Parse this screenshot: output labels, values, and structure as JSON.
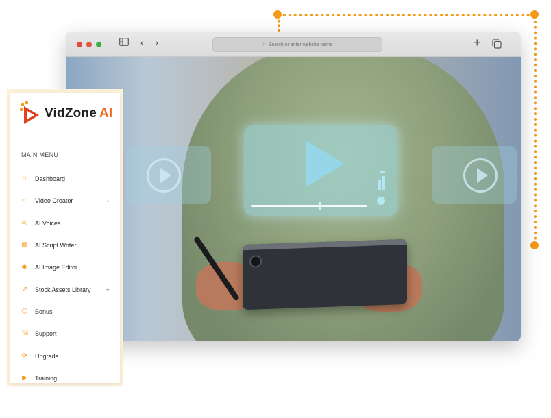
{
  "colors": {
    "accent": "#f39a16",
    "brand_red": "#e2421b",
    "brand_ai": "#f0661c",
    "text_dark": "#2b2b2b"
  },
  "browser": {
    "address_placeholder": "Search or enter website name",
    "icons": [
      "sidebar-toggle-icon",
      "back-arrow-icon",
      "forward-arrow-icon",
      "new-tab-plus-icon",
      "tabs-overview-icon"
    ]
  },
  "sidebar": {
    "brand_name": "VidZone",
    "brand_suffix": "AI",
    "menu_title": "MAIN MENU",
    "items": [
      {
        "label": "Dashboard",
        "icon": "home-icon",
        "glyph": "⌂",
        "has_submenu": false
      },
      {
        "label": "Video Creator",
        "icon": "monitor-icon",
        "glyph": "▭",
        "has_submenu": true
      },
      {
        "label": "AI Voices",
        "icon": "microphone-icon",
        "glyph": "◎",
        "has_submenu": false
      },
      {
        "label": "AI Script Writer",
        "icon": "document-icon",
        "glyph": "▤",
        "has_submenu": false
      },
      {
        "label": "AI Image Editor",
        "icon": "image-edit-icon",
        "glyph": "◉",
        "has_submenu": false
      },
      {
        "label": "Stock Assets Library",
        "icon": "trending-icon",
        "glyph": "↗",
        "has_submenu": true
      },
      {
        "label": "Bonus",
        "icon": "gift-box-icon",
        "glyph": "⬡",
        "has_submenu": false
      },
      {
        "label": "Support",
        "icon": "support-icon",
        "glyph": "☏",
        "has_submenu": false
      },
      {
        "label": "Upgrade",
        "icon": "refresh-icon",
        "glyph": "⟳",
        "has_submenu": false
      },
      {
        "label": "Training",
        "icon": "video-camera-icon",
        "glyph": "▶",
        "has_submenu": false
      }
    ]
  }
}
